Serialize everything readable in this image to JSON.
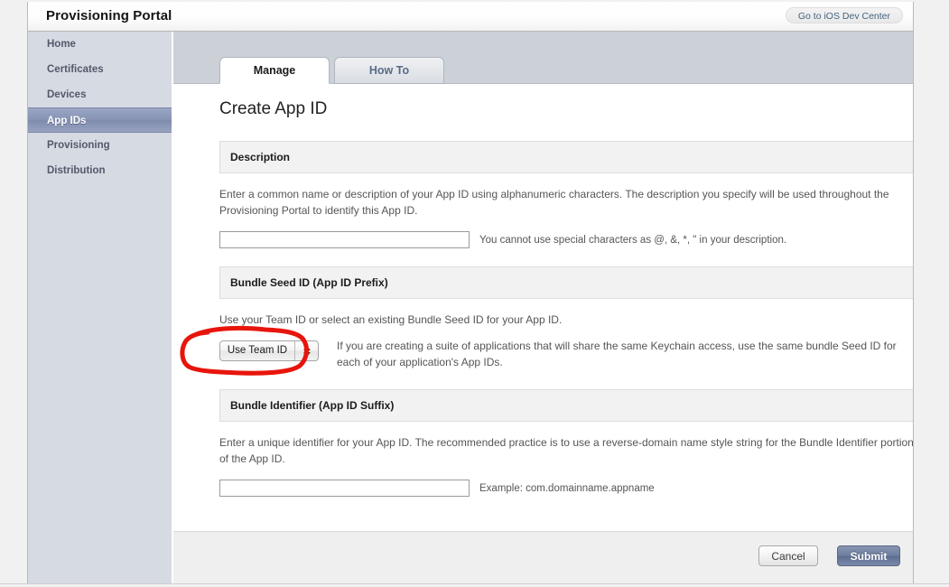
{
  "masthead": {
    "title": "Provisioning Portal",
    "dev_center_button": "Go to iOS Dev Center"
  },
  "sidebar": {
    "items": [
      {
        "label": "Home",
        "selected": false
      },
      {
        "label": "Certificates",
        "selected": false
      },
      {
        "label": "Devices",
        "selected": false
      },
      {
        "label": "App IDs",
        "selected": true
      },
      {
        "label": "Provisioning",
        "selected": false
      },
      {
        "label": "Distribution",
        "selected": false
      }
    ]
  },
  "tabs": [
    {
      "label": "Manage",
      "active": true
    },
    {
      "label": "How To",
      "active": false
    }
  ],
  "main": {
    "heading": "Create App ID",
    "sections": {
      "description": {
        "header": "Description",
        "paragraph": "Enter a common name or description of your App ID using alphanumeric characters. The description you specify will be used throughout the Provisioning Portal to identify this App ID.",
        "input_value": "",
        "input_placeholder": "",
        "hint": "You cannot use special characters as @, &, *, \" in your description."
      },
      "bundle_seed_id": {
        "header": "Bundle Seed ID (App ID Prefix)",
        "paragraph": "Use your Team ID or select an existing Bundle Seed ID for your App ID.",
        "select_value": "Use Team ID",
        "note": "If you are creating a suite of applications that will share the same Keychain access, use the same bundle Seed ID for each of your application's App IDs."
      },
      "bundle_identifier": {
        "header": "Bundle Identifier (App ID Suffix)",
        "paragraph": "Enter a unique identifier for your App ID. The recommended practice is to use a reverse-domain name style string for the Bundle Identifier portion of the App ID.",
        "input_value": "",
        "input_placeholder": "",
        "hint": "Example: com.domainname.appname"
      }
    }
  },
  "footer": {
    "cancel_label": "Cancel",
    "submit_label": "Submit"
  },
  "annotation": {
    "shape": "hand-drawn-red-ellipse",
    "color": "#e8150c",
    "targets": "bundle-seed-id-select"
  },
  "colors": {
    "selected_nav": "#8793b4",
    "submit_button": "#6e7e9f",
    "annotation_red": "#e8150c",
    "sidebar_bg": "#d6dae2",
    "tabstrip_bg": "#ccd1d8"
  }
}
